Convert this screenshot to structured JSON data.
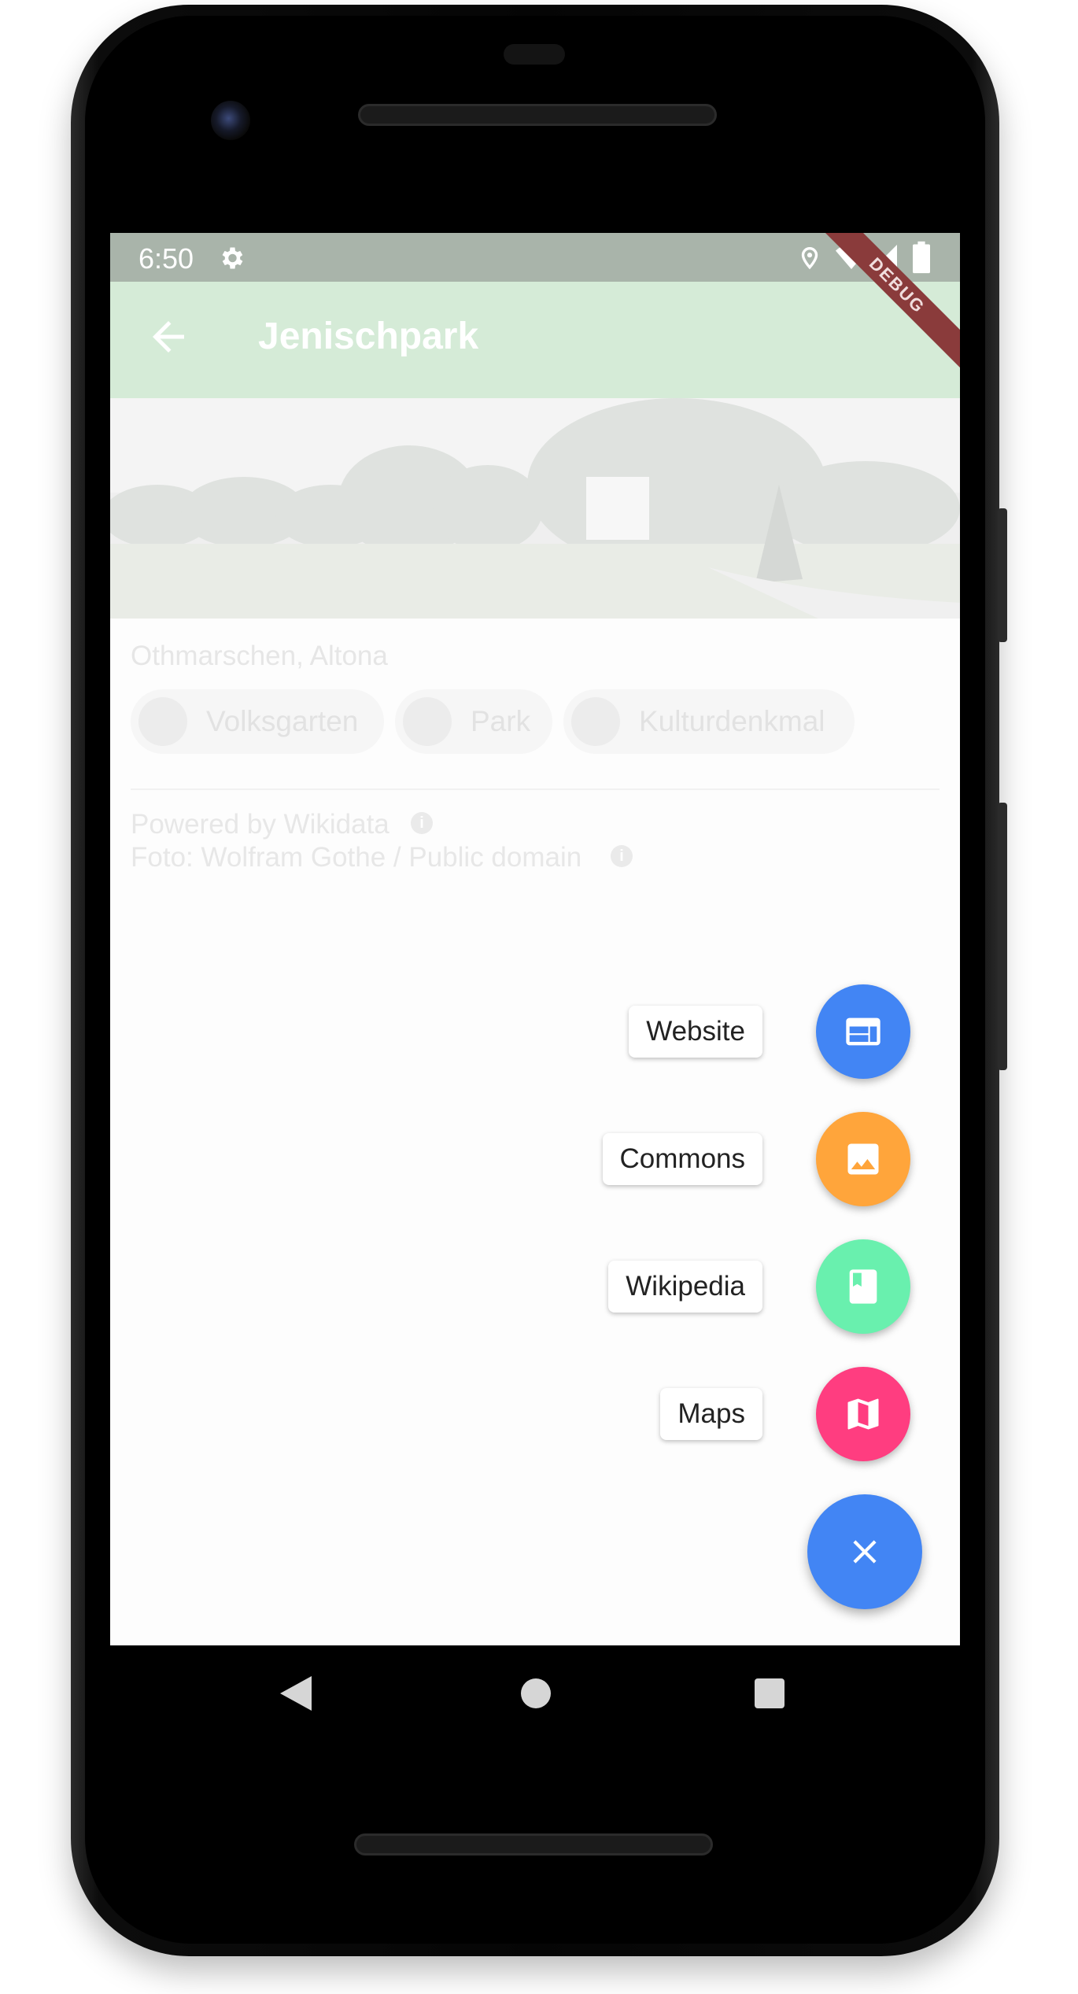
{
  "statusbar": {
    "time": "6:50",
    "icons": [
      "settings-icon",
      "location-icon",
      "wifi-icon",
      "signal-icon",
      "battery-icon"
    ]
  },
  "debug_banner": "DEBUG",
  "appbar": {
    "title": "Jenischpark",
    "back_icon": "arrow-left-icon",
    "bg_color": "#d5ebd7"
  },
  "place": {
    "location": "Othmarschen, Altona",
    "chips": [
      {
        "label": "Volksgarten",
        "icon": "tree-icon"
      },
      {
        "label": "Park",
        "icon": "tree-icon"
      },
      {
        "label": "Kulturdenkmal",
        "icon": "tree-icon"
      }
    ],
    "credits": {
      "powered": "Powered by Wikidata",
      "photo": "Foto: Wolfram Gothe / Public domain"
    }
  },
  "fab_menu": {
    "items": [
      {
        "label": "Website",
        "icon": "web-icon",
        "color": "#4285f4"
      },
      {
        "label": "Commons",
        "icon": "image-icon",
        "color": "#ffa53b"
      },
      {
        "label": "Wikipedia",
        "icon": "book-icon",
        "color": "#69f0ae"
      },
      {
        "label": "Maps",
        "icon": "map-icon",
        "color": "#ff3d80"
      }
    ],
    "main_icon": "close-icon",
    "main_color": "#4285f4"
  },
  "navbar": {
    "icons": [
      "back-triangle-icon",
      "home-circle-icon",
      "recents-square-icon"
    ]
  }
}
